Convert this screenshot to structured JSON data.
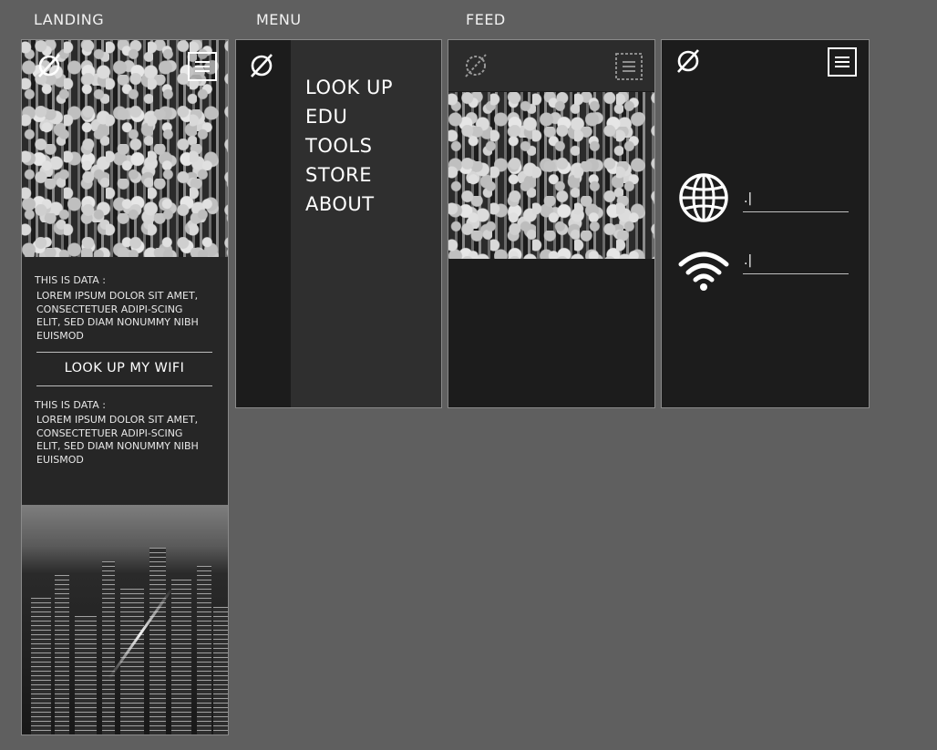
{
  "labels": {
    "landing": "LANDING",
    "menu": "MENU",
    "feed": "FEED"
  },
  "landing": {
    "data_label_1": "THIS IS DATA :",
    "data_text_1": "LOREM IPSUM DOLOR SIT AMET, CONSECTETUER ADIPI-SCING ELIT, SED DIAM NONUMMY NIBH EUISMOD",
    "cta": "LOOK UP MY WIFI",
    "data_label_2": "THIS IS DATA :",
    "data_text_2": "LOREM IPSUM DOLOR SIT AMET, CONSECTETUER ADIPI-SCING ELIT, SED DIAM NONUMMY NIBH EUISMOD"
  },
  "menu": {
    "items": [
      "LOOK UP",
      "EDU",
      "TOOLS",
      "STORE",
      "ABOUT"
    ]
  },
  "lookup": {
    "globe_field_value": ".|",
    "wifi_field_value": ".|"
  },
  "icons": {
    "logo": "empty-set-icon",
    "menu": "hamburger-menu-icon",
    "globe": "globe-icon",
    "wifi": "wifi-icon"
  },
  "colors": {
    "background": "#5f5f5f",
    "panel_dark": "#1c1c1c",
    "panel_mid": "#2e2e2e",
    "text": "#ffffff"
  }
}
